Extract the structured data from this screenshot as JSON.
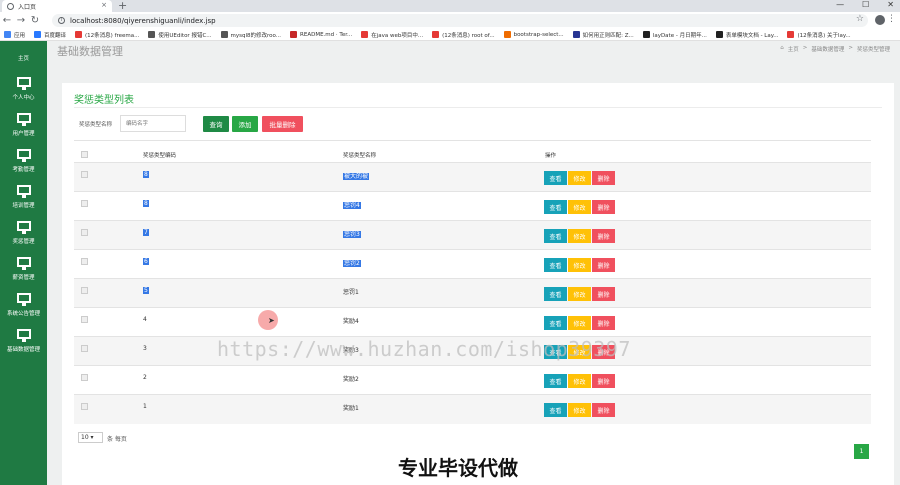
{
  "browser": {
    "tab_title": "入口页",
    "url": "localhost:8080/qiyerenshiguanli/index.jsp",
    "window_controls": [
      "—",
      "☐",
      "✕"
    ],
    "bookmarks": [
      {
        "label": "应用",
        "color": "#4285f4"
      },
      {
        "label": "百度翻译",
        "color": "#2979ff"
      },
      {
        "label": "(12条消息) freema...",
        "color": "#e53935"
      },
      {
        "label": "使用UEditor 报错C...",
        "color": "#555555"
      },
      {
        "label": "mysql8的修改roo...",
        "color": "#555555"
      },
      {
        "label": "README.md · Ter...",
        "color": "#c62828"
      },
      {
        "label": "在java web项目中...",
        "color": "#e53935"
      },
      {
        "label": "(12条消息) root of...",
        "color": "#e53935"
      },
      {
        "label": "bootstrap-select...",
        "color": "#ef6c00"
      },
      {
        "label": "如何用正则匹配: Z...",
        "color": "#283593"
      },
      {
        "label": "layDate - 月日期年...",
        "color": "#212121"
      },
      {
        "label": "表单模块文档 - Lay...",
        "color": "#212121"
      },
      {
        "label": "(12条消息) 关于lay...",
        "color": "#e53935"
      }
    ]
  },
  "sidebar": {
    "items": [
      {
        "label": "主页"
      },
      {
        "label": "个人中心"
      },
      {
        "label": "用户管理"
      },
      {
        "label": "考勤管理"
      },
      {
        "label": "培训管理"
      },
      {
        "label": "奖惩管理"
      },
      {
        "label": "薪资管理"
      },
      {
        "label": "系统公告管理"
      },
      {
        "label": "基础数据管理"
      }
    ]
  },
  "header": {
    "page_title": "基础数据管理",
    "breadcrumb": [
      "主页",
      ">",
      "基础数据管理",
      ">",
      "奖惩类型管理"
    ]
  },
  "card": {
    "title": "奖惩类型列表",
    "search_label": "奖惩类型名称",
    "search_placeholder": "编码名字",
    "btn_query": "查询",
    "btn_add": "添加",
    "btn_batch_delete": "批量删除"
  },
  "table": {
    "headers": [
      "奖惩类型编码",
      "奖惩类型名称",
      "操作"
    ],
    "rows": [
      {
        "code": "8",
        "name": "被大的被",
        "selected": true
      },
      {
        "code": "8",
        "name": "惩罚4",
        "selected": true
      },
      {
        "code": "7",
        "name": "惩罚3",
        "selected": true
      },
      {
        "code": "6",
        "name": "惩罚2",
        "selected": true
      },
      {
        "code": "5",
        "name": "惩罚1",
        "selected": false,
        "code_selected": true
      },
      {
        "code": "4",
        "name": "奖励4",
        "selected": false
      },
      {
        "code": "3",
        "name": "奖励3",
        "selected": false
      },
      {
        "code": "2",
        "name": "奖励2",
        "selected": false
      },
      {
        "code": "1",
        "name": "奖励1",
        "selected": false
      }
    ],
    "op_view": "查看",
    "op_edit": "修改",
    "op_delete": "删除"
  },
  "pager": {
    "page_size": "10 ▾",
    "per_page_label": "条 每页",
    "current_page": "1"
  },
  "watermark": "https://www.huzhan.com/ishop39397",
  "overlay_caption": "专业毕设代做",
  "colors": {
    "sidebar": "#1f7a43",
    "accent_green": "#28a745",
    "danger": "#f0505e",
    "info": "#17a2b8",
    "warning": "#ffc107"
  }
}
